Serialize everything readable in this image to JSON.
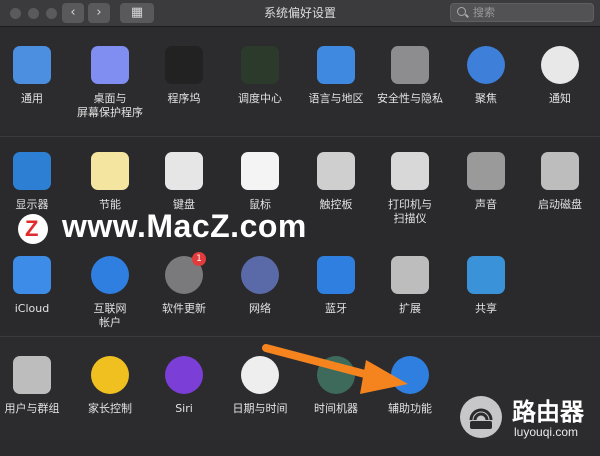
{
  "window": {
    "title": "系统偏好设置"
  },
  "toolbar": {
    "back": "‹",
    "forward": "›",
    "grid": "▦",
    "search_placeholder": "搜索"
  },
  "rows": [
    [
      {
        "label": "通用",
        "icon": "general-icon",
        "color": "#4c8fe0"
      },
      {
        "label": "桌面与\n屏幕保护程序",
        "icon": "desktop-icon",
        "color": "#7f8ef0"
      },
      {
        "label": "程序坞",
        "icon": "dock-icon",
        "color": "#222222"
      },
      {
        "label": "调度中心",
        "icon": "mission-control-icon",
        "color": "#2b3a2b"
      },
      {
        "label": "语言与地区",
        "icon": "flag-icon",
        "color": "#3f8ae0"
      },
      {
        "label": "安全性与隐私",
        "icon": "house-lock-icon",
        "color": "#8d8d8f"
      },
      {
        "label": "聚焦",
        "icon": "spotlight-icon",
        "color": "#3d7fd9"
      },
      {
        "label": "通知",
        "icon": "notifications-icon",
        "color": "#e8e8e8"
      }
    ],
    [
      {
        "label": "显示器",
        "icon": "display-icon",
        "color": "#2d7fd4"
      },
      {
        "label": "节能",
        "icon": "bulb-icon",
        "color": "#f4e6a0"
      },
      {
        "label": "键盘",
        "icon": "keyboard-icon",
        "color": "#e6e6e6"
      },
      {
        "label": "鼠标",
        "icon": "mouse-icon",
        "color": "#f4f4f4"
      },
      {
        "label": "触控板",
        "icon": "trackpad-icon",
        "color": "#cfcfcf"
      },
      {
        "label": "打印机与\n扫描仪",
        "icon": "printer-icon",
        "color": "#d8d8d8"
      },
      {
        "label": "声音",
        "icon": "speaker-icon",
        "color": "#9a9a9a"
      },
      {
        "label": "启动磁盘",
        "icon": "disk-icon",
        "color": "#bdbdbd"
      }
    ],
    [
      {
        "label": "iCloud",
        "icon": "icloud-icon",
        "color": "#3d8ce8"
      },
      {
        "label": "互联网\n帐户",
        "icon": "at-icon",
        "color": "#2f7fe0"
      },
      {
        "label": "软件更新",
        "icon": "gear-icon",
        "color": "#7a7a7c",
        "badge": "1"
      },
      {
        "label": "网络",
        "icon": "globe-icon",
        "color": "#5a6aa8"
      },
      {
        "label": "蓝牙",
        "icon": "bluetooth-icon",
        "color": "#2f7fe0"
      },
      {
        "label": "扩展",
        "icon": "puzzle-icon",
        "color": "#bdbdbd"
      },
      {
        "label": "共享",
        "icon": "sharing-folder-icon",
        "color": "#3a92d8"
      }
    ],
    [
      {
        "label": "用户与群组",
        "icon": "users-icon",
        "color": "#bdbdbd"
      },
      {
        "label": "家长控制",
        "icon": "parental-icon",
        "color": "#f0c020"
      },
      {
        "label": "Siri",
        "icon": "siri-icon",
        "color": "#7b3fd8"
      },
      {
        "label": "日期与时间",
        "icon": "clock-icon",
        "color": "#eeeeee"
      },
      {
        "label": "时间机器",
        "icon": "time-machine-icon",
        "color": "#3d6a5a"
      },
      {
        "label": "辅助功能",
        "icon": "accessibility-icon",
        "color": "#2f7fe0"
      }
    ]
  ],
  "watermark": {
    "badge": "Z",
    "text": "www.MacZ.com"
  },
  "logo": {
    "name": "路由器",
    "url": "luyouqi.com"
  },
  "colors": {
    "arrow": "#f5841f"
  }
}
